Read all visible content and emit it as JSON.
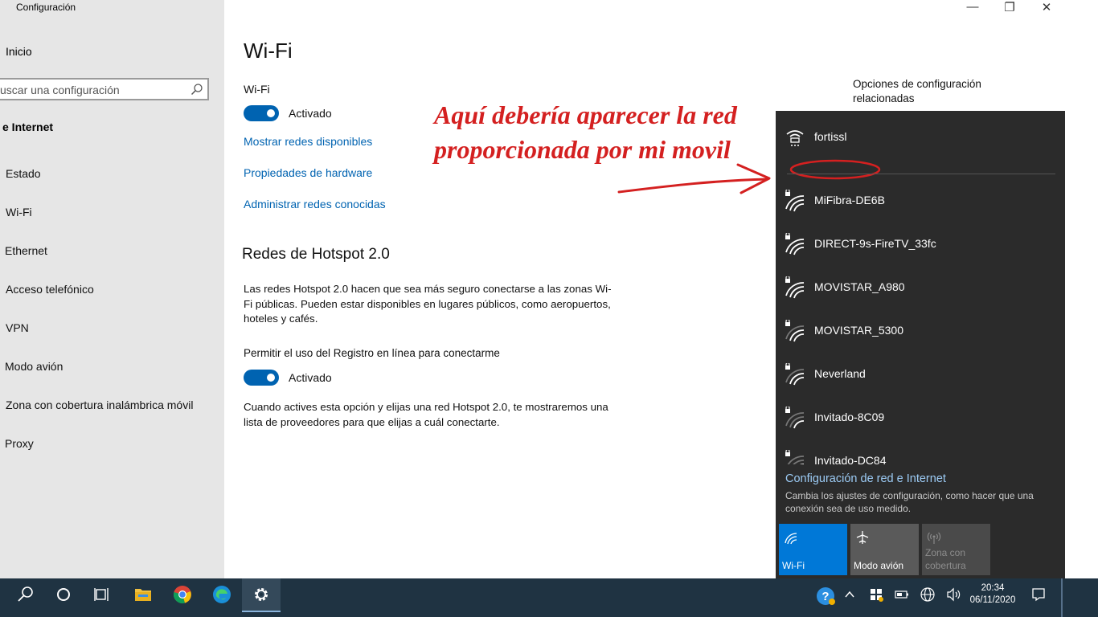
{
  "window": {
    "app_title": "Configuración",
    "minimize": "—",
    "maximize": "❐",
    "close": "✕"
  },
  "sidebar": {
    "home": "Inicio",
    "search_placeholder": "uscar una configuración",
    "section": "e Internet",
    "items": [
      {
        "label": "Estado"
      },
      {
        "label": "Wi-Fi"
      },
      {
        "label": "Ethernet"
      },
      {
        "label": "Acceso telefónico"
      },
      {
        "label": "VPN"
      },
      {
        "label": "Modo avión"
      },
      {
        "label": "Zona con cobertura inalámbrica móvil"
      },
      {
        "label": "Proxy"
      }
    ]
  },
  "main": {
    "title": "Wi-Fi",
    "wifi_label": "Wi-Fi",
    "wifi_state": "Activado",
    "links": {
      "show_networks": "Mostrar redes disponibles",
      "hardware": "Propiedades de hardware",
      "known": "Administrar redes conocidas"
    },
    "hotspot_heading": "Redes de Hotspot 2.0",
    "hotspot_desc": "Las redes Hotspot 2.0 hacen que sea más seguro conectarse a las zonas Wi-Fi públicas. Pueden estar disponibles en lugares públicos, como aeropuertos, hoteles y cafés.",
    "online_reg_label": "Permitir el uso del Registro en línea para conectarme",
    "online_reg_state": "Activado",
    "online_reg_desc": "Cuando actives esta opción y elijas una red Hotspot 2.0, te mostraremos una lista de proveedores para que elijas a cuál conectarte.",
    "related_title": "Opciones de configuración relacionadas"
  },
  "annotation": {
    "line1": "Aquí debería aparecer la red",
    "line2": "proporcionada por mi movil",
    "color": "#d42020"
  },
  "flyout": {
    "vpn_network": "fortissl",
    "networks": [
      {
        "name": "MiFibra-DE6B",
        "secured": true,
        "signal": 3
      },
      {
        "name": "DIRECT-9s-FireTV_33fc",
        "secured": true,
        "signal": 3
      },
      {
        "name": "MOVISTAR_A980",
        "secured": true,
        "signal": 3
      },
      {
        "name": "MOVISTAR_5300",
        "secured": true,
        "signal": 2
      },
      {
        "name": "Neverland",
        "secured": true,
        "signal": 2
      },
      {
        "name": "Invitado-8C09",
        "secured": true,
        "signal": 1
      },
      {
        "name": "Invitado-DC84",
        "secured": true,
        "signal": 1
      }
    ],
    "settings_link": "Configuración de red e Internet",
    "settings_desc": "Cambia los ajustes de configuración, como hacer que una conexión sea de uso medido.",
    "quick_actions": [
      {
        "label": "Wi-Fi",
        "state": "on",
        "icon": "wifi-icon"
      },
      {
        "label": "Modo avión",
        "state": "off",
        "icon": "airplane-icon"
      },
      {
        "label": "Zona con cobertura",
        "state": "disabled",
        "icon": "hotspot-icon"
      }
    ],
    "accent": "#0078d7"
  },
  "taskbar": {
    "time": "20:34",
    "date": "06/11/2020",
    "pinned": [
      "search-icon",
      "cortana-icon",
      "task-view-icon",
      "file-explorer-icon",
      "chrome-icon",
      "edge-icon",
      "settings-icon"
    ]
  }
}
